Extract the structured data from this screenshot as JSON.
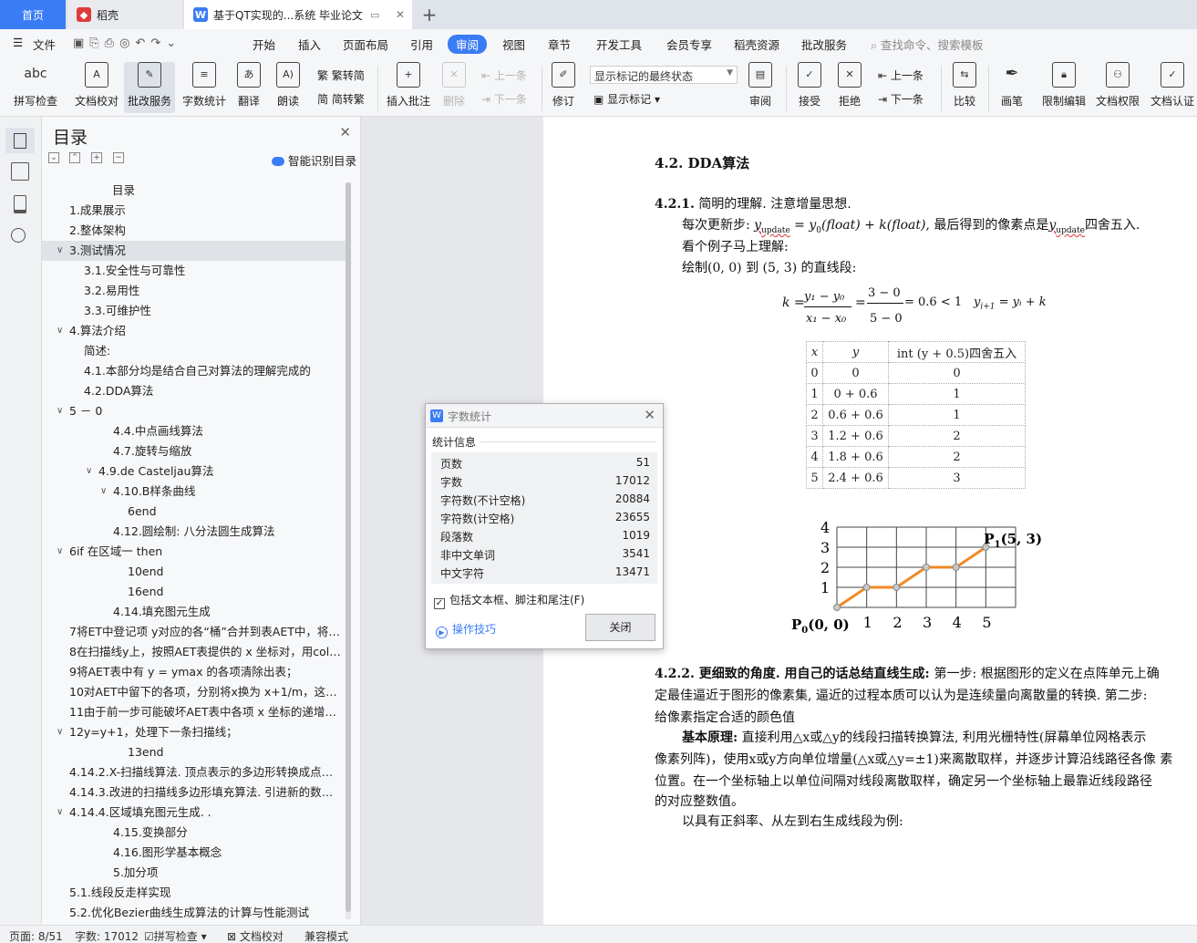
{
  "tabs": {
    "home": "首页",
    "daoke": "稻壳",
    "doc": "基于QT实现的...系统 毕业论文"
  },
  "menu": [
    "文件",
    "开始",
    "插入",
    "页面布局",
    "引用",
    "审阅",
    "视图",
    "章节",
    "开发工具",
    "会员专享",
    "稻壳资源",
    "批改服务"
  ],
  "menu_search": "查找命令、搜索模板",
  "ribbon": {
    "spell": "拼写检查",
    "proof": "文档校对",
    "correct": "批改服务",
    "wordcount": "字数统计",
    "translate": "翻译",
    "read": "朗读",
    "trad": "繁转简",
    "simp": "简转繁",
    "insert_comment": "插入批注",
    "delete": "删除",
    "prev_comment": "上一条",
    "next_comment": "下一条",
    "revise": "修订",
    "track_state": "显示标记的最终状态",
    "show_markup": "显示标记",
    "review": "审阅",
    "accept": "接受",
    "reject": "拒绝",
    "prev_change": "上一条",
    "next_change": "下一条",
    "compare": "比较",
    "pen": "画笔",
    "restrict": "限制编辑",
    "perm": "文档权限",
    "auth": "文档认证"
  },
  "toc": {
    "title": "目录",
    "smart": "智能识别目录",
    "items": [
      {
        "text": "目录",
        "indent": 1
      },
      {
        "text": "1.成果展示",
        "indent": 0
      },
      {
        "text": "2.整体架构",
        "indent": 0
      },
      {
        "text": "3.测试情况",
        "indent": 0,
        "caret": "∨",
        "selected": true
      },
      {
        "text": "3.1.安全性与可靠性",
        "indent": 1
      },
      {
        "text": "3.2.易用性",
        "indent": 1
      },
      {
        "text": "3.3.可维护性",
        "indent": 1
      },
      {
        "text": "4.算法介绍",
        "indent": 0,
        "caret": "∨"
      },
      {
        "text": "简述:",
        "indent": 1
      },
      {
        "text": "4.1.本部分均是结合自己对算法的理解完成的",
        "indent": 1
      },
      {
        "text": "4.2.DDA算法",
        "indent": 1
      },
      {
        "text": "5 － 0",
        "indent": 0,
        "caret": "∨"
      },
      {
        "text": "4.4.中点画线算法",
        "indent": 3
      },
      {
        "text": "4.7.旋转与缩放",
        "indent": 3
      },
      {
        "text": "4.9.de Casteljau算法",
        "indent": 2,
        "caret": "∨"
      },
      {
        "text": "4.10.B样条曲线",
        "indent": 3,
        "caret": "∨"
      },
      {
        "text": "6end",
        "indent": 4
      },
      {
        "text": "4.12.圆绘制: 八分法圆生成算法",
        "indent": 3
      },
      {
        "text": "6if 在区域一 then",
        "indent": 0,
        "caret": "∨"
      },
      {
        "text": "10end",
        "indent": 4
      },
      {
        "text": "16end",
        "indent": 4
      },
      {
        "text": "4.14.填充图元生成",
        "indent": 3
      },
      {
        "text": "7将ET中登记项 y对应的各“桶”合并到表AET中，将AET表中的各项按 x 值递增排序；",
        "indent": 0
      },
      {
        "text": "8在扫描线y上，按照AET表提供的 x 坐标对，用color实施填充；",
        "indent": 0
      },
      {
        "text": "9将AET表中有 y = ymax 的各项清除出表；",
        "indent": 0
      },
      {
        "text": "10对AET中留下的各项，分别将x换为 x+1/m，这是求出交点的迭代计算；",
        "indent": 0
      },
      {
        "text": "11由于前一步可能破坏AET表中各项 x 坐标的递增次序，需重新排序；",
        "indent": 0
      },
      {
        "text": "12y=y+1，处理下一条扫描线；",
        "indent": 0,
        "caret": "∨"
      },
      {
        "text": "13end",
        "indent": 4
      },
      {
        "text": "4.14.2.X-扫描线算法. 顶点表示的多边形转换成点阵表示的多边形",
        "indent": 0
      },
      {
        "text": "4.14.3.改进的扫描线多边形填充算法. 引进新的数据结构",
        "indent": 0
      },
      {
        "text": "4.14.4.区域填充图元生成. .",
        "indent": 0,
        "caret": "∨"
      },
      {
        "text": "4.15.变换部分",
        "indent": 3
      },
      {
        "text": "4.16.图形学基本概念",
        "indent": 3
      },
      {
        "text": "5.加分项",
        "indent": 3
      },
      {
        "text": "5.1.线段反走样实现",
        "indent": 0
      },
      {
        "text": "5.2.优化Bezier曲线生成算法的计算与性能测试",
        "indent": 0
      }
    ]
  },
  "doc": {
    "h42": "4.2.  DDA算法",
    "h421_num": "4.2.1.",
    "h421_title": " 简明的理解. 注意增量思想.",
    "p1a": "每次更新步: ",
    "p1_yupdate": "y",
    "p1_sub": "update",
    "p1_mid": " = y",
    "p1_sub2": "0",
    "p1_eq": "(float) + k(float)",
    "p1_tail": ", 最后得到的像素点是",
    "p1_tail2": "四舍五入.",
    "p2": "看个例子马上理解:",
    "p3": "绘制(0, 0) 到  (5, 3) 的直线段:",
    "formula_k": "k =",
    "formula_num1": "y₁ − y₀",
    "formula_den1": "x₁ − x₀",
    "formula_num2": "3 − 0",
    "formula_den2": "5 − 0",
    "formula_res": "= 0.6 < 1",
    "formula_iter": "y",
    "formula_iter_sub": "i+1",
    "formula_iter_tail": " = yᵢ + k",
    "table_head": [
      "x",
      "y",
      "int (y + 0.5)四舍五入"
    ],
    "table_rows": [
      [
        "0",
        "0",
        "0"
      ],
      [
        "1",
        "0 + 0.6",
        "1"
      ],
      [
        "2",
        "0.6 + 0.6",
        "1"
      ],
      [
        "3",
        "1.2 + 0.6",
        "2"
      ],
      [
        "4",
        "1.8 + 0.6",
        "2"
      ],
      [
        "5",
        "2.4 + 0.6",
        "3"
      ]
    ],
    "chart_p0": "P",
    "chart_p0_sub": "0",
    "chart_p0_tail": "(0, 0)",
    "chart_p1": "P",
    "chart_p1_sub": "1",
    "chart_p1_tail": "(5, 3)",
    "h422_num": "4.2.2.",
    "h422_title": " 更细致的角度. 用自己的话总结直线生成: ",
    "h422_body1": "第一步: 根据图形的定义在点阵单元上确",
    "h422_body2": "定最佳逼近于图形的像素集, 逼近的过程本质可以认为是连续量向离散量的转换. 第二步:",
    "h422_body3": "给像素指定合适的颜色值",
    "basic_label": "基本原理:",
    "basic1": " 直接利用△x或△y的线段扫描转换算法, 利用光栅特性(屏幕单位网格表示",
    "basic2": "像素列阵)，使用x或y方向单位增量(△x或△y=±1)来离散取样，并逐步计算沿线路径各像   素",
    "basic3": "位置。在一个坐标轴上以单位间隔对线段离散取样，确定另一个坐标轴上最靠近线段路径",
    "basic4": "的对应整数值。",
    "last": "以具有正斜率、从左到右生成线段为例:"
  },
  "chart_data": {
    "type": "line",
    "x": [
      0,
      1,
      2,
      3,
      4,
      5
    ],
    "y": [
      0,
      1,
      1,
      2,
      2,
      3
    ],
    "xticks": [
      "1",
      "2",
      "3",
      "4",
      "5"
    ],
    "yticks": [
      "1",
      "2",
      "3",
      "4"
    ],
    "xlim": [
      0,
      6
    ],
    "ylim": [
      0,
      4
    ],
    "grid": true,
    "line_color": "#f08a24"
  },
  "dialog": {
    "title": "字数统计",
    "section": "统计信息",
    "rows": [
      {
        "label": "页数",
        "value": "51"
      },
      {
        "label": "字数",
        "value": "17012"
      },
      {
        "label": "字符数(不计空格)",
        "value": "20884"
      },
      {
        "label": "字符数(计空格)",
        "value": "23655"
      },
      {
        "label": "段落数",
        "value": "1019"
      },
      {
        "label": "非中文单词",
        "value": "3541"
      },
      {
        "label": "中文字符",
        "value": "13471"
      }
    ],
    "checkbox": "包括文本框、脚注和尾注(F)",
    "tips": "操作技巧",
    "close": "关闭"
  },
  "status": {
    "page": "页面: 8/51",
    "words": "字数: 17012",
    "spell": "拼写检查",
    "proof": "文档校对",
    "compat": "兼容模式"
  },
  "colors": {
    "accent": "#3a7cf5",
    "orange": "#f08a24"
  }
}
